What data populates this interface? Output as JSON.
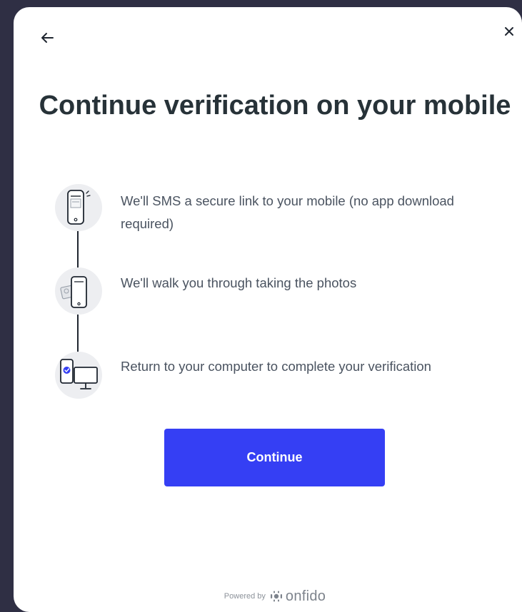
{
  "header": {
    "back_icon": "arrow-left-icon",
    "close_label": "×"
  },
  "title": "Continue verification on your mobile",
  "steps": [
    {
      "icon": "phone-sms-icon",
      "text": "We'll SMS a secure link to your mobile (no app download required)"
    },
    {
      "icon": "phone-document-icon",
      "text": "We'll walk you through taking the photos"
    },
    {
      "icon": "computer-phone-icon",
      "text": "Return to your computer to complete your verification"
    }
  ],
  "continue_label": "Continue",
  "footer": {
    "powered_by": "Powered by",
    "brand": "onfido"
  },
  "colors": {
    "backdrop": "#2f2f44",
    "primary": "#353ff4",
    "title": "#273238",
    "text": "#4a5360"
  }
}
